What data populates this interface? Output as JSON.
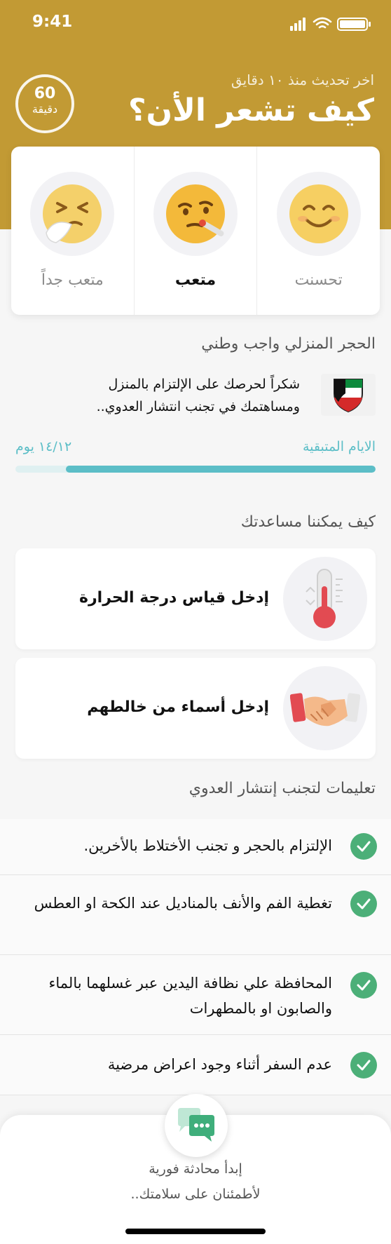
{
  "status": {
    "time": "9:41"
  },
  "header": {
    "updated": "اخر تحديث منذ ١٠ دقايق",
    "title": "كيف تشعر الأن؟",
    "timer_value": "60",
    "timer_unit": "دقيقة",
    "bg_color": "#c29a34"
  },
  "moods": [
    {
      "label": "تحسنت",
      "icon": "smiling-face-icon",
      "selected": false
    },
    {
      "label": "متعب",
      "icon": "face-with-thermometer-icon",
      "selected": true
    },
    {
      "label": "متعب جداً",
      "icon": "sneezing-face-icon",
      "selected": false
    }
  ],
  "quarantine": {
    "title": "الحجر المنزلي واجب وطني",
    "message": "شكراً لحرصك على الإلتزام بالمنزل ومساهتمك في تجنب انتشار العدوي..",
    "flag_icon": "kuwait-flag-shield-icon",
    "days_label": "الايام المتبقية",
    "days_value": "١٤/١٢ يوم",
    "progress_fraction": 0.86,
    "accent_color": "#5cbec7"
  },
  "help": {
    "title": "كيف يمكننا مساعدتك",
    "items": [
      {
        "label": "إدخل قياس درجة الحرارة",
        "icon": "thermometer-icon"
      },
      {
        "label": "إدخل أسماء من خالطهم",
        "icon": "handshake-icon"
      }
    ]
  },
  "tips": {
    "title": "تعليمات لتجنب إنتشار العدوي",
    "items": [
      "الإلتزام بالحجر و تجنب الأختلاط بالأخرين.",
      "تغطية الفم والأنف بالمناديل عند الكحة او العطس",
      "المحافظة علي نظافة اليدين عبر غسلهما بالماء والصابون او بالمطهرات",
      "عدم السفر أثناء وجود اعراض مرضية"
    ],
    "check_color": "#4caf78"
  },
  "chat": {
    "line1": "إبدأ محادثة فورية",
    "line2": "لأطمئنان على سلامتك..",
    "icon": "chat-bubbles-icon"
  }
}
